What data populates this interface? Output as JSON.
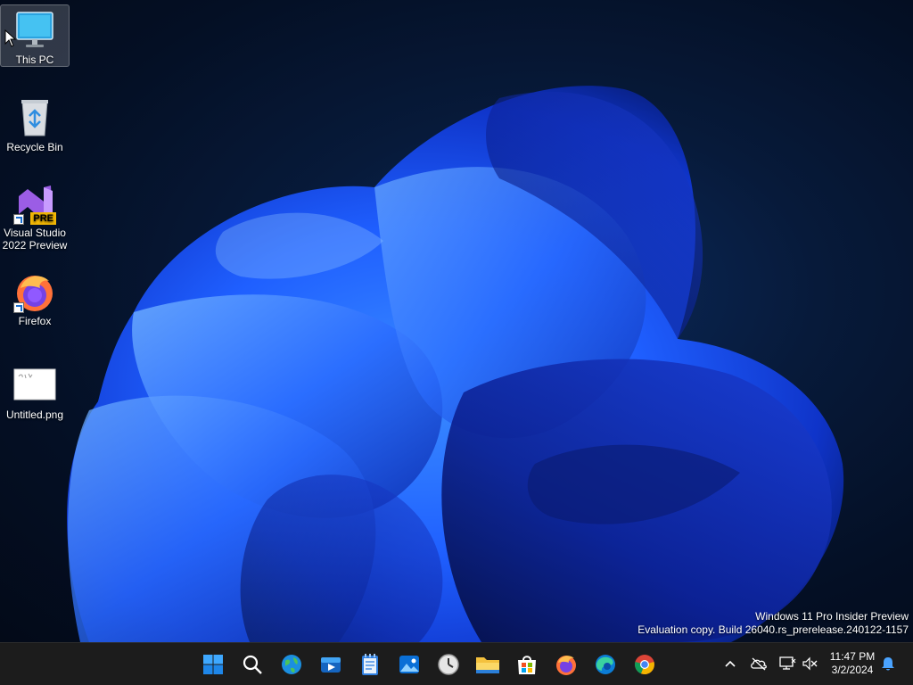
{
  "desktop": {
    "icons": [
      {
        "label": "This PC",
        "icon": "monitor-icon",
        "selected": true
      },
      {
        "label": "Recycle Bin",
        "icon": "recycle-bin-icon"
      },
      {
        "label": "Visual Studio\n2022 Preview",
        "icon": "visual-studio-icon",
        "badge": "PRE",
        "shortcut": true
      },
      {
        "label": "Firefox",
        "icon": "firefox-icon",
        "shortcut": true
      },
      {
        "label": "Untitled.png",
        "icon": "image-file-icon"
      }
    ],
    "watermark": {
      "line1": "Windows 11 Pro Insider Preview",
      "line2": "Evaluation copy. Build 26040.rs_prerelease.240122-1157"
    }
  },
  "taskbar": {
    "apps": [
      {
        "name": "start-button",
        "icon": "windows-logo-icon"
      },
      {
        "name": "search-button",
        "icon": "search-icon"
      },
      {
        "name": "taskbar-globe-app",
        "icon": "globe-icon"
      },
      {
        "name": "taskbar-media-player",
        "icon": "media-player-icon"
      },
      {
        "name": "taskbar-notepad",
        "icon": "notepad-icon"
      },
      {
        "name": "taskbar-photos",
        "icon": "photos-icon"
      },
      {
        "name": "taskbar-clock-app",
        "icon": "clock-icon"
      },
      {
        "name": "taskbar-file-explorer",
        "icon": "folder-icon"
      },
      {
        "name": "taskbar-store",
        "icon": "store-icon"
      },
      {
        "name": "taskbar-firefox",
        "icon": "firefox-icon"
      },
      {
        "name": "taskbar-edge",
        "icon": "edge-icon"
      },
      {
        "name": "taskbar-chrome",
        "icon": "chrome-icon"
      }
    ],
    "tray": {
      "chevron": "chevron-up-icon",
      "onedrive": "cloud-offline-icon",
      "network": "network-disconnected-icon",
      "volume": "volume-muted-icon",
      "time": "11:47 PM",
      "date": "3/2/2024",
      "notifications": "bell-icon"
    }
  },
  "colors": {
    "accent_blue": "#1f5fff",
    "taskbar_bg": "#1c1c1c",
    "wallpaper_dark": "#040f24"
  }
}
